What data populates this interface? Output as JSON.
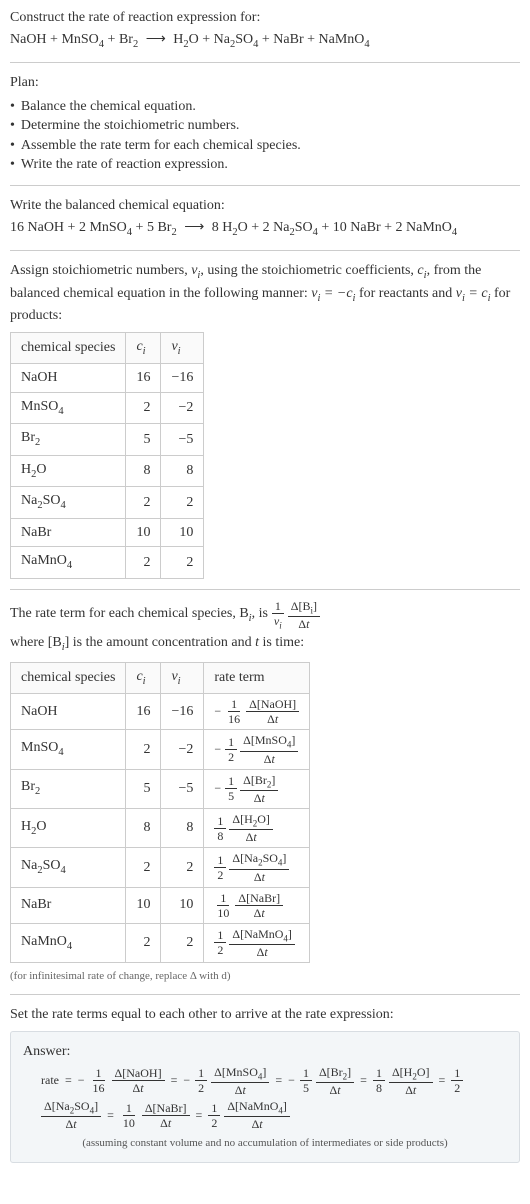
{
  "intro": {
    "prompt": "Construct the rate of reaction expression for:",
    "eq_lhs": "NaOH + MnSO",
    "eq_rhs_after": " + Br",
    "arrow": "⟶",
    "rhs": "H",
    "rhs2": "O + Na",
    "rhs3": "SO",
    "rhs4": " + NaBr + NaMnO"
  },
  "plan": {
    "heading": "Plan:",
    "items": [
      "Balance the chemical equation.",
      "Determine the stoichiometric numbers.",
      "Assemble the rate term for each chemical species.",
      "Write the rate of reaction expression."
    ]
  },
  "balance": {
    "heading": "Write the balanced chemical equation:",
    "eq": "16 NaOH + 2 MnSO₄ + 5 Br₂ ⟶ 8 H₂O + 2 Na₂SO₄ + 10 NaBr + 2 NaMnO₄"
  },
  "assign": {
    "text1": "Assign stoichiometric numbers, ",
    "nu": "ν",
    "sub_i": "i",
    "text2": ", using the stoichiometric coefficients, ",
    "c": "c",
    "text3": ", from the balanced chemical equation in the following manner: ",
    "rel1": "νᵢ = −cᵢ",
    "text4": " for reactants and ",
    "rel2": "νᵢ = cᵢ",
    "text5": " for products:"
  },
  "table1": {
    "headers": [
      "chemical species",
      "cᵢ",
      "νᵢ"
    ],
    "rows": [
      {
        "sp": "NaOH",
        "c": "16",
        "v": "−16"
      },
      {
        "sp": "MnSO₄",
        "c": "2",
        "v": "−2"
      },
      {
        "sp": "Br₂",
        "c": "5",
        "v": "−5"
      },
      {
        "sp": "H₂O",
        "c": "8",
        "v": "8"
      },
      {
        "sp": "Na₂SO₄",
        "c": "2",
        "v": "2"
      },
      {
        "sp": "NaBr",
        "c": "10",
        "v": "10"
      },
      {
        "sp": "NaMnO₄",
        "c": "2",
        "v": "2"
      }
    ]
  },
  "rateterm": {
    "t1": "The rate term for each chemical species, B",
    "t2": ", is ",
    "frac_top": "1",
    "frac_bot": "νᵢ",
    "frac2_top": "Δ[Bᵢ]",
    "frac2_bot": "Δt",
    "t3": " where [B",
    "t4": "] is the amount concentration and ",
    "t_var": "t",
    "t5": " is time:"
  },
  "table2": {
    "headers": [
      "chemical species",
      "cᵢ",
      "νᵢ",
      "rate term"
    ],
    "rows": [
      {
        "sp": "NaOH",
        "c": "16",
        "v": "−16",
        "sign": "−",
        "d": "16",
        "conc": "Δ[NaOH]"
      },
      {
        "sp": "MnSO₄",
        "c": "2",
        "v": "−2",
        "sign": "−",
        "d": "2",
        "conc": "Δ[MnSO₄]"
      },
      {
        "sp": "Br₂",
        "c": "5",
        "v": "−5",
        "sign": "−",
        "d": "5",
        "conc": "Δ[Br₂]"
      },
      {
        "sp": "H₂O",
        "c": "8",
        "v": "8",
        "sign": "",
        "d": "8",
        "conc": "Δ[H₂O]"
      },
      {
        "sp": "Na₂SO₄",
        "c": "2",
        "v": "2",
        "sign": "",
        "d": "2",
        "conc": "Δ[Na₂SO₄]"
      },
      {
        "sp": "NaBr",
        "c": "10",
        "v": "10",
        "sign": "",
        "d": "10",
        "conc": "Δ[NaBr]"
      },
      {
        "sp": "NaMnO₄",
        "c": "2",
        "v": "2",
        "sign": "",
        "d": "2",
        "conc": "Δ[NaMnO₄]"
      }
    ],
    "dt": "Δt",
    "one": "1"
  },
  "note1": "(for infinitesimal rate of change, replace Δ with d)",
  "final": {
    "heading": "Set the rate terms equal to each other to arrive at the rate expression:",
    "answer_label": "Answer:",
    "rate_word": "rate",
    "eq": "=",
    "terms": [
      {
        "sign": "−",
        "d": "16",
        "conc": "Δ[NaOH]"
      },
      {
        "sign": "−",
        "d": "2",
        "conc": "Δ[MnSO₄]"
      },
      {
        "sign": "−",
        "d": "5",
        "conc": "Δ[Br₂]"
      },
      {
        "sign": "",
        "d": "8",
        "conc": "Δ[H₂O]"
      },
      {
        "sign": "",
        "d": "2",
        "conc": "Δ[Na₂SO₄]"
      },
      {
        "sign": "",
        "d": "10",
        "conc": "Δ[NaBr]"
      },
      {
        "sign": "",
        "d": "2",
        "conc": "Δ[NaMnO₄]"
      }
    ],
    "dt": "Δt",
    "one": "1",
    "note": "(assuming constant volume and no accumulation of intermediates or side products)"
  }
}
